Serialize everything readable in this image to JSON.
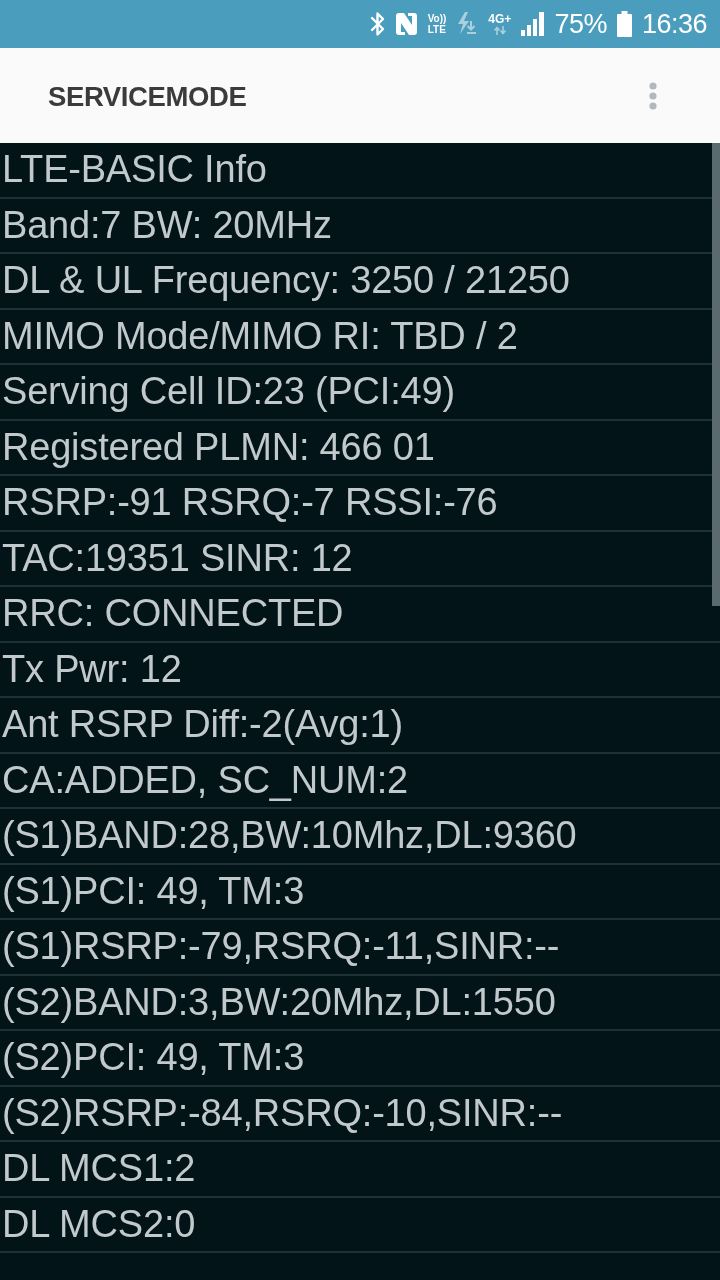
{
  "status_bar": {
    "volte": [
      "Vo))",
      "LTE"
    ],
    "network_type": "4G+",
    "battery": "75%",
    "time": "16:36"
  },
  "app_bar": {
    "title": "SERVICEMODE"
  },
  "info_rows": [
    "LTE-BASIC Info",
    "Band:7 BW: 20MHz",
    "DL & UL Frequency: 3250 / 21250",
    "MIMO Mode/MIMO RI: TBD / 2",
    "Serving Cell ID:23 (PCI:49)",
    "Registered PLMN: 466 01",
    "RSRP:-91 RSRQ:-7 RSSI:-76",
    "TAC:19351 SINR: 12",
    "RRC: CONNECTED",
    "Tx Pwr: 12",
    "Ant RSRP Diff:-2(Avg:1)",
    "CA:ADDED, SC_NUM:2",
    "(S1)BAND:28,BW:10Mhz,DL:9360",
    "(S1)PCI: 49, TM:3",
    "(S1)RSRP:-79,RSRQ:-11,SINR:--",
    "(S2)BAND:3,BW:20Mhz,DL:1550",
    "(S2)PCI: 49, TM:3",
    "(S2)RSRP:-84,RSRQ:-10,SINR:--",
    "DL MCS1:2",
    "DL MCS2:0"
  ]
}
